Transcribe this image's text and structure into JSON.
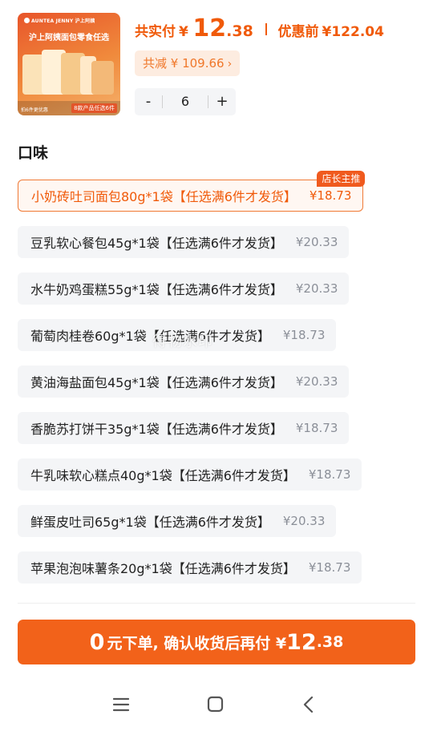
{
  "product": {
    "brand": "AUNTEA JENNY 沪上阿姨",
    "image_headline": "沪上阿姨面包零食任选",
    "image_foot_left": "拍6件更优惠",
    "image_foot_right": "8款产品任选6件"
  },
  "summary": {
    "pay_label": "共实付",
    "currency": "¥",
    "pay_int": "12",
    "pay_dec": ".38",
    "pre_label": "优惠前",
    "pre_value": "¥122.04",
    "saved_text": "共减 ¥ 109.66",
    "saved_chevron": "›"
  },
  "stepper": {
    "minus": "-",
    "value": "6",
    "plus": "+"
  },
  "section_title": "口味",
  "options": [
    {
      "name": "小奶砖吐司面包80g*1袋【任选满6件才发货】",
      "price": "¥18.73",
      "selected": true,
      "badge": "店长主推"
    },
    {
      "name": "豆乳软心餐包45g*1袋【任选满6件才发货】",
      "price": "¥20.33"
    },
    {
      "name": "水牛奶鸡蛋糕55g*1袋【任选满6件才发货】",
      "price": "¥20.33"
    },
    {
      "name": "葡萄肉桂卷60g*1袋【任选满6件才发货】",
      "price": "¥18.73"
    },
    {
      "name": "黄油海盐面包45g*1袋【任选满6件才发货】",
      "price": "¥20.33"
    },
    {
      "name": "香脆苏打饼干35g*1袋【任选满6件才发货】",
      "price": "¥18.73"
    },
    {
      "name": "牛乳味软心糕点40g*1袋【任选满6件才发货】",
      "price": "¥18.73"
    },
    {
      "name": "鲜蛋皮吐司65g*1袋【任选满6件才发货】",
      "price": "¥20.33"
    },
    {
      "name": "苹果泡泡味薯条20g*1袋【任选满6件才发货】",
      "price": "¥18.73"
    }
  ],
  "watermark": "得物水印",
  "cta": {
    "zero": "0",
    "mid": "元下单, 确认收货后再付 ¥",
    "int": "12",
    "dec": ".38"
  },
  "colors": {
    "accent": "#f05a0a",
    "cta_bg": "#f2621a",
    "saved_bg": "#fdece0",
    "option_bg": "#f4f5f7"
  },
  "icons": {
    "menu": "menu-icon",
    "home": "home-square-icon",
    "back": "back-chevron-icon"
  }
}
